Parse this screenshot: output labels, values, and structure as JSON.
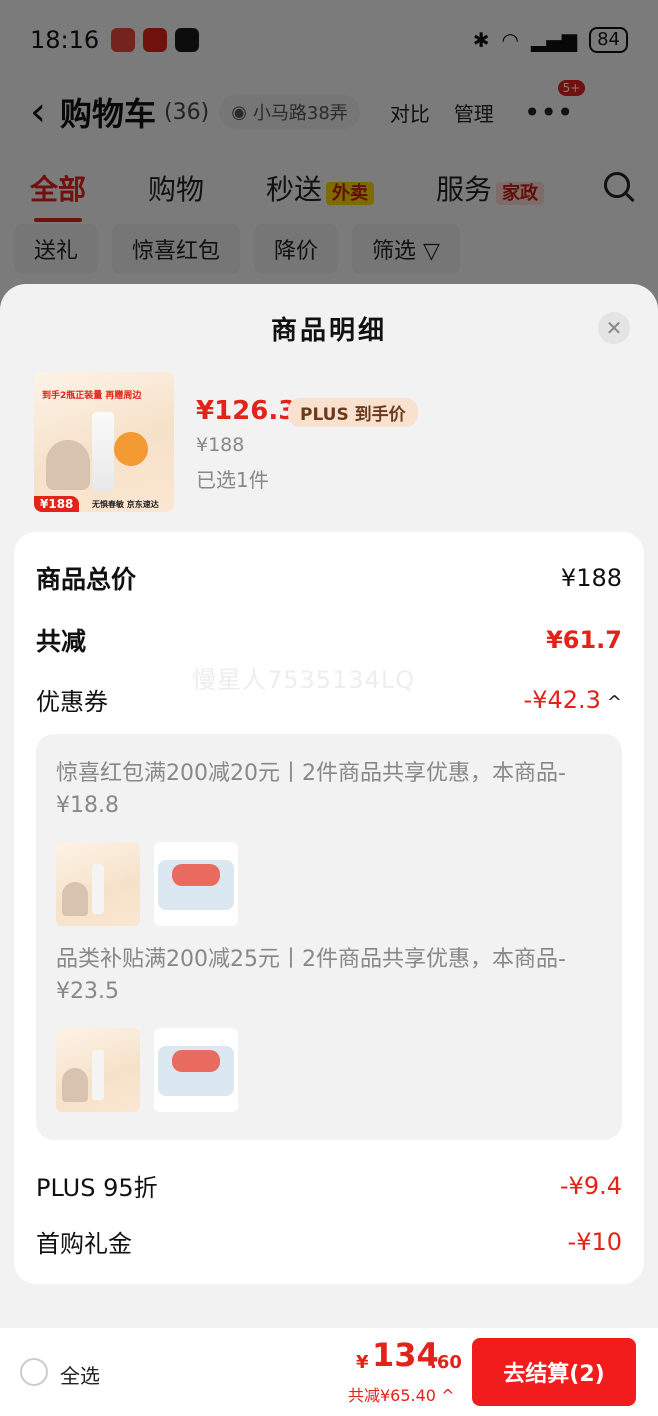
{
  "status_bar": {
    "time": "18:16",
    "battery": "84"
  },
  "nav": {
    "back_glyph": "‹",
    "title": "购物车",
    "count": "(36)",
    "location": "小马路38弄",
    "compare": "对比",
    "manage": "管理",
    "more_badge": "5+"
  },
  "tabs": [
    {
      "label": "全部"
    },
    {
      "label": "购物"
    },
    {
      "label": "秒送",
      "tag": "外卖"
    },
    {
      "label": "服务",
      "tag": "家政"
    }
  ],
  "filters": [
    "送礼",
    "惊喜红包",
    "降价",
    "筛选 ▽"
  ],
  "sheet": {
    "title": "商品明细",
    "close_glyph": "✕",
    "product": {
      "price": "¥126.3",
      "plus_tag": "PLUS 到手价",
      "original_price": "¥188",
      "selected": "已选1件",
      "thumb_title": "到手2瓶正装量 再赠周边",
      "thumb_price": "¥188",
      "thumb_footer": "无惧春敏 京东速达"
    },
    "breakdown": {
      "total_label": "商品总价",
      "total_value": "¥188",
      "reduce_label": "共减",
      "reduce_value": "¥61.7",
      "watermark": "慢星人7535134LQ",
      "coupon_label": "优惠券",
      "coupon_value": "-¥42.3",
      "coupons": [
        {
          "desc": "惊喜红包满200减20元丨2件商品共享优惠，本商品-¥18.8"
        },
        {
          "desc": "品类补贴满200减25元丨2件商品共享优惠，本商品-¥23.5"
        }
      ],
      "plus_label": "PLUS 95折",
      "plus_value": "-¥9.4",
      "gift_label": "首购礼金",
      "gift_value": "-¥10"
    }
  },
  "bottom_bar": {
    "select_all": "全选",
    "yen": "¥",
    "total_int": "134",
    "total_dec": ".60",
    "saved": "共减¥65.40 ^",
    "checkout": "去结算(2)"
  },
  "colors": {
    "accent": "#e2231a",
    "button": "#f21c1c"
  }
}
